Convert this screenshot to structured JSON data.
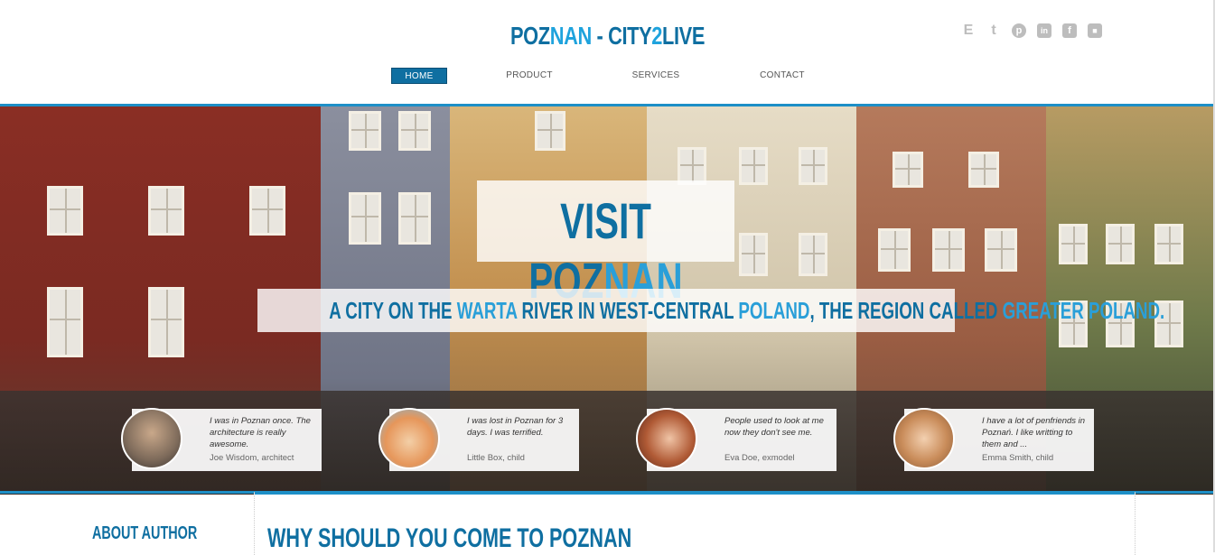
{
  "logo": {
    "part1": "POZ",
    "part2": "NAN",
    "part3": " - CITY",
    "part4": "2",
    "part5": "LIVE"
  },
  "social": [
    {
      "name": "evernote-icon",
      "glyph": "E"
    },
    {
      "name": "twitter-icon",
      "glyph": "t"
    },
    {
      "name": "pinterest-icon",
      "glyph": "p"
    },
    {
      "name": "linkedin-icon",
      "glyph": "in"
    },
    {
      "name": "facebook-icon",
      "glyph": "f"
    },
    {
      "name": "delicious-icon",
      "glyph": "■"
    }
  ],
  "nav": {
    "home": "HOME",
    "product": "PRODUCT",
    "services": "SERVICES",
    "contact": "CONTACT"
  },
  "hero": {
    "title_a": "VISIT POZ",
    "title_b": "NAN",
    "sub_1": "A CITY ON THE ",
    "sub_2": "WARTA",
    "sub_3": " RIVER IN WEST-CENTRAL ",
    "sub_4": "POLAND",
    "sub_5": ", THE REGION CALLED ",
    "sub_6": "GREATER POLAND."
  },
  "testimonials": [
    {
      "quote": "I was in Poznan once. The architecture is really awesome.",
      "author": "Joe Wisdom, architect"
    },
    {
      "quote": "I was lost in Poznan for 3 days. I was terrified.",
      "author": "Little Box, child"
    },
    {
      "quote": "People used to look at me now they don't see me.",
      "author": "Eva Doe, exmodel"
    },
    {
      "quote": "I have a lot of penfriends in Poznań. I like writting to them and ...",
      "author": "Emma Smith, child"
    }
  ],
  "sidebar": {
    "heading": "ABOUT AUTHOR"
  },
  "main": {
    "heading": "WHY SHOULD YOU COME TO POZNAN"
  },
  "colors": {
    "brand_dark": "#0f6fa1",
    "brand_light": "#1fa3dd",
    "accent_line": "#1d8fc7"
  }
}
